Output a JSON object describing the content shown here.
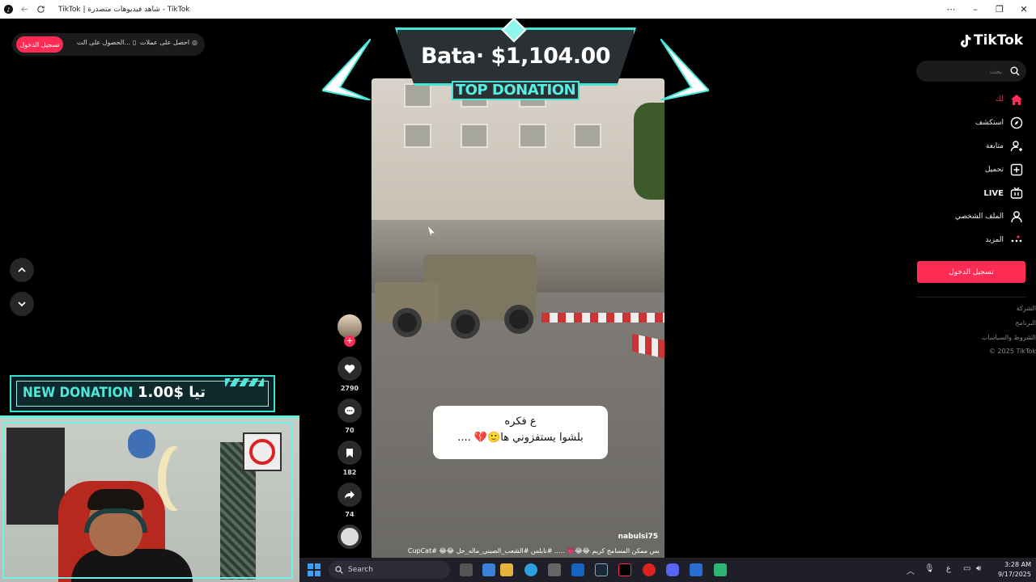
{
  "window": {
    "title": "TikTok | شاهد فيديوهات متصدرة - TikTok"
  },
  "top_pills": {
    "login": "تسجيل الدخول",
    "get_app": "الحصول على الت...",
    "get_coins": "احصل على عملات"
  },
  "overlay": {
    "top_donation_amount": "Bata· $1,104.00",
    "top_donation_label": "TOP DONATION",
    "new_donation_label": "NEW DONATION",
    "new_donation_amount": "1.00$ تيا"
  },
  "video": {
    "caption_line1": "ع فكره",
    "caption_line2": "بلشوا يستفزوني ها🙂💔 ....",
    "username": "nabulsi75",
    "description": "بس ممكن المسامح كريم 😂😂💗 ..... #نابلس #الشعب_الصيني_ماله_حل 😂😂 #CupCat",
    "progress": 0.62
  },
  "actions": {
    "likes": "2790",
    "comments": "70",
    "saves": "182",
    "shares": "74"
  },
  "sidebar": {
    "logo": "TikTok",
    "search_placeholder": "بحث",
    "nav": [
      {
        "label": "لك",
        "icon": "home-icon",
        "active": true
      },
      {
        "label": "استكشف",
        "icon": "compass-icon"
      },
      {
        "label": "متابعة",
        "icon": "following-icon"
      },
      {
        "label": "تحميل",
        "icon": "upload-icon"
      },
      {
        "label": "LIVE",
        "icon": "live-icon"
      },
      {
        "label": "الملف الشخصي",
        "icon": "profile-icon"
      },
      {
        "label": "المزيد",
        "icon": "more-icon"
      }
    ],
    "login_button": "تسجيل الدخول",
    "footer": [
      "الشركة",
      "البرنامج",
      "الشروط والسياسات",
      "© 2025 TikTok"
    ]
  },
  "taskbar": {
    "search": "Search",
    "lang": "ع",
    "time": "3:28 AM",
    "date": "9/17/2025"
  },
  "colors": {
    "accent": "#fe2c55",
    "overlay_cyan": "#45e6d8"
  }
}
